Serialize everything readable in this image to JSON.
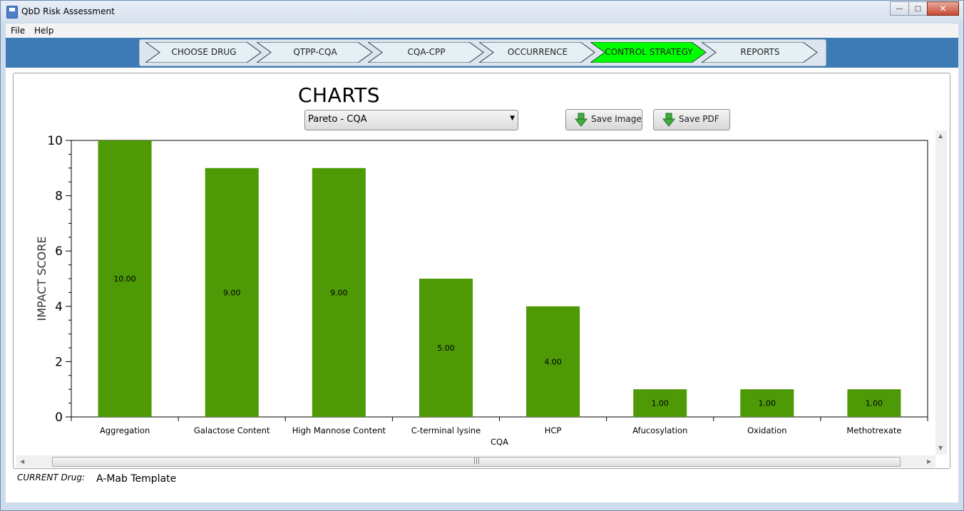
{
  "window": {
    "title": "QbD Risk Assessment"
  },
  "menu": {
    "items": [
      "File",
      "Help"
    ]
  },
  "wizard": {
    "steps": [
      {
        "label": "CHOOSE DRUG",
        "active": false
      },
      {
        "label": "QTPP-CQA",
        "active": false
      },
      {
        "label": "CQA-CPP",
        "active": false
      },
      {
        "label": "OCCURRENCE",
        "active": false
      },
      {
        "label": "CONTROL STRATEGY",
        "active": true
      },
      {
        "label": "REPORTS",
        "active": false
      }
    ],
    "active_color": "#00ff00",
    "inactive_color": "#e4f0f4"
  },
  "charts": {
    "title": "CHARTS",
    "chart_select_value": "Pareto - CQA",
    "save_image_label": "Save Image",
    "save_pdf_label": "Save PDF"
  },
  "chart_data": {
    "type": "bar",
    "xlabel": "CQA",
    "ylabel": "IMPACT SCORE",
    "categories": [
      "Aggregation",
      "Galactose Content",
      "High Mannose Content",
      "C-terminal lysine",
      "HCP",
      "Afucosylation",
      "Oxidation",
      "Methotrexate"
    ],
    "values": [
      10,
      9,
      9,
      5,
      4,
      1,
      1,
      1
    ],
    "data_labels": [
      "10.00",
      "9.00",
      "9.00",
      "5.00",
      "4.00",
      "1.00",
      "1.00",
      "1.00"
    ],
    "ylim": [
      0,
      10
    ],
    "yticks": [
      0,
      2,
      4,
      6,
      8,
      10
    ],
    "bar_color": "#4e9a06",
    "grid": false
  },
  "status": {
    "label": "CURRENT Drug:",
    "value": "A-Mab Template"
  }
}
